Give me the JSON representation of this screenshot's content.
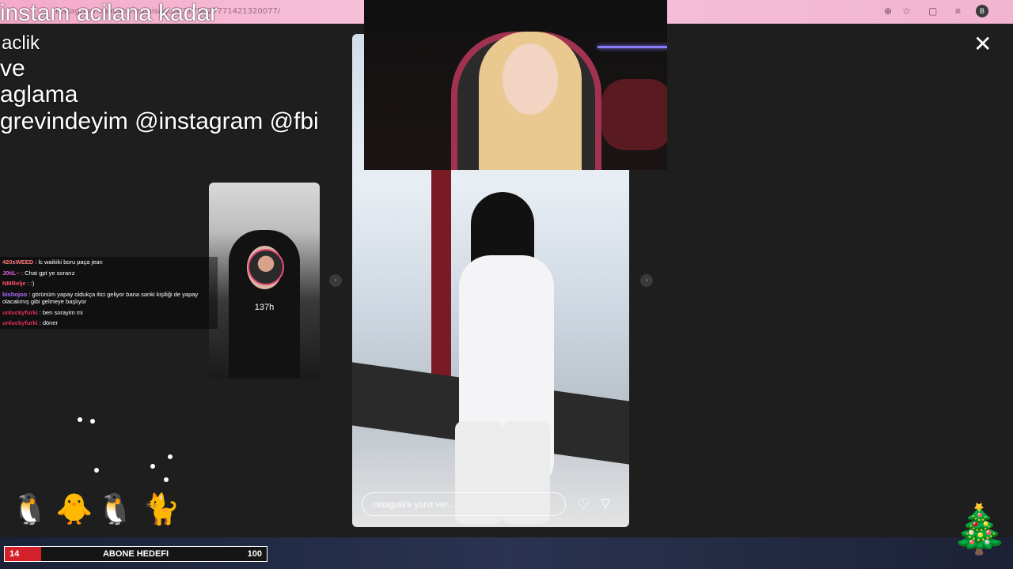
{
  "browser": {
    "url": "instagram.com/stories/nisaguls/3179627771421320077/",
    "profile_initial": "B",
    "icons": [
      "zoom-icon",
      "star-icon",
      "extensions-icon",
      "reading-list-icon"
    ]
  },
  "overlay_text": {
    "line1": "instam acilana kadar",
    "line2": "aclik",
    "line3": "ve",
    "line4": "aglama",
    "line5": "grevindeyim @instagram @fbi"
  },
  "story_small": {
    "time": "137h"
  },
  "story_main": {
    "reply_placeholder": "nisaguls'e yanıt ver..."
  },
  "chat": [
    {
      "user": "420sWEED",
      "text": " : lc waikiki boru paça jean",
      "color": "#ff7a7a"
    },
    {
      "user": "J0tiL~",
      "text": " : Chat gpt ye sorarız",
      "color": "#e05be0"
    },
    {
      "user": "NMRelje",
      "text": " : :)",
      "color": "#ff4d6d"
    },
    {
      "user": "bishojoo",
      "text": " : görünüm yapay oldukça itici geliyor bana sanki kişiliği de yapay olacakmış gibi gelmeye başlıyor",
      "color": "#b36bff"
    },
    {
      "user": "unluckyfurki",
      "text": " : ben sorayim mi",
      "color": "#e8325a"
    },
    {
      "user": "unluckyfurki",
      "text": " : döner",
      "color": "#e8325a"
    }
  ],
  "goal": {
    "current": "14",
    "title": "ABONE HEDEFI",
    "max": "100",
    "progress": 0.14,
    "fill_color": "#d4202b"
  },
  "colors": {
    "browser_bar": "#f4a9c9",
    "background": "#1b1b1b",
    "accent": "#e94b7b"
  }
}
